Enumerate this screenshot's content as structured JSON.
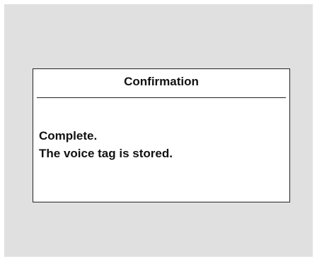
{
  "dialog": {
    "title": "Confirmation",
    "message_lines": [
      "Complete.",
      "The voice tag is stored."
    ]
  },
  "colors": {
    "screen_background": "#e0e0e0",
    "dialog_background": "#ffffff",
    "border": "#222222",
    "text": "#111111"
  }
}
